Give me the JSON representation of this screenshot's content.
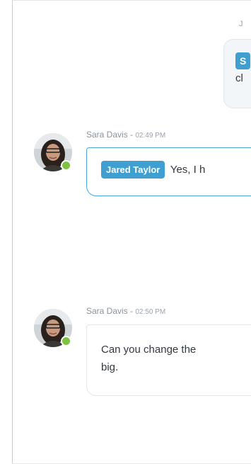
{
  "chat": {
    "outgoing": {
      "meta": "J",
      "mention": "S",
      "text": "cl"
    },
    "messages": [
      {
        "author": "Sara Davis",
        "separator": " - ",
        "time": "02:49 PM",
        "mention": "Jared Taylor",
        "text": "Yes, I h",
        "status": "online"
      },
      {
        "author": "Sara Davis",
        "separator": " - ",
        "time": "02:50 PM",
        "text_line1": "Can you change the",
        "text_line2": "big.",
        "status": "online"
      }
    ]
  },
  "colors": {
    "accent": "#3f9fd0",
    "online": "#7cc243",
    "meta_text": "#8a929b",
    "body_text": "#333840"
  },
  "icons": {
    "status": "online-status-dot"
  }
}
